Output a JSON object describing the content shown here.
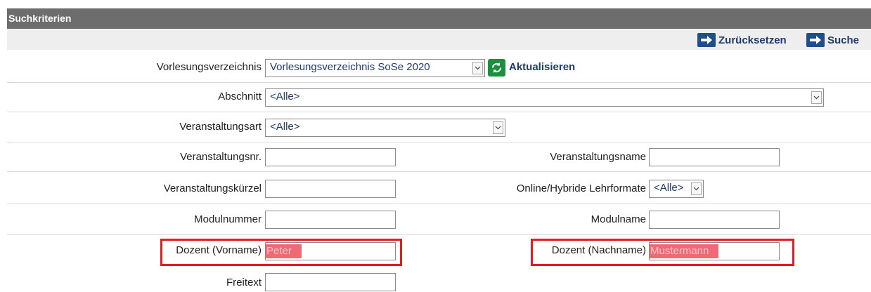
{
  "header": {
    "title": "Suchkriterien"
  },
  "actions": {
    "reset_label": "Zurücksetzen",
    "search_label": "Suche"
  },
  "fields": {
    "vorlesungsverzeichnis": {
      "label": "Vorlesungsverzeichnis",
      "value": "Vorlesungsverzeichnis SoSe 2020",
      "refresh_label": "Aktualisieren"
    },
    "abschnitt": {
      "label": "Abschnitt",
      "value": "<Alle>"
    },
    "veranstaltungsart": {
      "label": "Veranstaltungsart",
      "value": "<Alle>"
    },
    "veranstaltungsnr": {
      "label": "Veranstaltungsnr.",
      "value": ""
    },
    "veranstaltungsname": {
      "label": "Veranstaltungsname",
      "value": ""
    },
    "veranstaltungskuerzel": {
      "label": "Veranstaltungskürzel",
      "value": ""
    },
    "lehrformate": {
      "label": "Online/Hybride Lehrformate",
      "value": "<Alle>"
    },
    "modulnummer": {
      "label": "Modulnummer",
      "value": ""
    },
    "modulname": {
      "label": "Modulname",
      "value": ""
    },
    "dozent_vorname": {
      "label": "Dozent (Vorname)",
      "value": "Peter"
    },
    "dozent_nachname": {
      "label": "Dozent (Nachname)",
      "value": "Mustermann"
    },
    "freitext": {
      "label": "Freitext",
      "value": ""
    }
  },
  "colors": {
    "header_bg": "#6d6d6d",
    "accent": "#1f3a6e",
    "highlight_border": "#e31b23",
    "highlight_fill": "#ef6b73"
  }
}
